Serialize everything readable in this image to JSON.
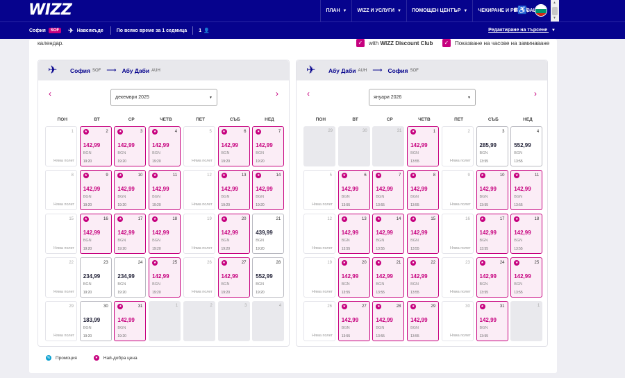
{
  "logo": "WIZZ",
  "nav": [
    {
      "label": "ПЛАН",
      "caret": true
    },
    {
      "label": "WIZZ И УСЛУГИ",
      "caret": true
    },
    {
      "label": "ПОМОЩЕН ЦЕНТЪР",
      "caret": true
    },
    {
      "label": "ЧЕКИРАНЕ И РЕЗЕРВАЦИИ",
      "caret": false
    }
  ],
  "login": "ВХОД",
  "subbar": {
    "origin": "София",
    "origin_code": "SOF",
    "destination": "Навсякъде",
    "when": "По всяко време за 1 седмица",
    "pax": "1",
    "edit": "Редактиране на търсене"
  },
  "intro": "календар.",
  "options": {
    "discount_prefix": "with ",
    "discount_bold": "WIZZ Discount Club",
    "show_times": "Показване на часове на заминаване"
  },
  "no_flight": "Няма полет",
  "weekdays": [
    "ПОН",
    "ВТ",
    "СР",
    "ЧЕТВ",
    "ПЕТ",
    "СЪБ",
    "НЕД"
  ],
  "legend": {
    "promo": "Промоция",
    "best": "Най-добра цена"
  },
  "colors": {
    "brand_blue": "#06038d",
    "brand_pink": "#c6007e"
  },
  "panels": [
    {
      "from": "София",
      "from_code": "SOF",
      "to": "Абу Даби",
      "to_code": "AUH",
      "month": "декември 2025",
      "cells": [
        [
          {
            "d": "1",
            "k": "empty"
          },
          {
            "d": "2",
            "k": "best",
            "p": "142,99",
            "c": "BGN",
            "t": "19:20"
          },
          {
            "d": "3",
            "k": "best",
            "p": "142,99",
            "c": "BGN",
            "t": "19:20"
          },
          {
            "d": "4",
            "k": "best",
            "p": "142,99",
            "c": "BGN",
            "t": "19:20"
          },
          {
            "d": "5",
            "k": "empty"
          },
          {
            "d": "6",
            "k": "best",
            "p": "142,99",
            "c": "BGN",
            "t": "19:20"
          },
          {
            "d": "7",
            "k": "best",
            "p": "142,99",
            "c": "BGN",
            "t": "19:20"
          }
        ],
        [
          {
            "d": "8",
            "k": "empty"
          },
          {
            "d": "9",
            "k": "best",
            "p": "142,99",
            "c": "BGN",
            "t": "19:20"
          },
          {
            "d": "10",
            "k": "best",
            "p": "142,99",
            "c": "BGN",
            "t": "19:20"
          },
          {
            "d": "11",
            "k": "best",
            "p": "142,99",
            "c": "BGN",
            "t": "19:20"
          },
          {
            "d": "12",
            "k": "empty"
          },
          {
            "d": "13",
            "k": "best",
            "p": "142,99",
            "c": "BGN",
            "t": "19:20"
          },
          {
            "d": "14",
            "k": "best",
            "p": "142,99",
            "c": "BGN",
            "t": "19:20"
          }
        ],
        [
          {
            "d": "15",
            "k": "empty"
          },
          {
            "d": "16",
            "k": "best",
            "p": "142,99",
            "c": "BGN",
            "t": "19:20"
          },
          {
            "d": "17",
            "k": "best",
            "p": "142,99",
            "c": "BGN",
            "t": "19:20"
          },
          {
            "d": "18",
            "k": "best",
            "p": "142,99",
            "c": "BGN",
            "t": "19:20"
          },
          {
            "d": "19",
            "k": "empty"
          },
          {
            "d": "20",
            "k": "best",
            "p": "142,99",
            "c": "BGN",
            "t": "19:20"
          },
          {
            "d": "21",
            "k": "price",
            "p": "439,99",
            "c": "BGN",
            "t": "19:20"
          }
        ],
        [
          {
            "d": "22",
            "k": "empty"
          },
          {
            "d": "23",
            "k": "price",
            "p": "234,99",
            "c": "BGN",
            "t": "19:20"
          },
          {
            "d": "24",
            "k": "price",
            "p": "234,99",
            "c": "BGN",
            "t": "19:20"
          },
          {
            "d": "25",
            "k": "best",
            "p": "142,99",
            "c": "BGN",
            "t": "19:20"
          },
          {
            "d": "26",
            "k": "empty"
          },
          {
            "d": "27",
            "k": "best",
            "p": "142,99",
            "c": "BGN",
            "t": "19:20"
          },
          {
            "d": "28",
            "k": "price",
            "p": "552,99",
            "c": "BGN",
            "t": "19:20"
          }
        ],
        [
          {
            "d": "29",
            "k": "empty"
          },
          {
            "d": "30",
            "k": "price",
            "p": "183,99",
            "c": "BGN",
            "t": "19:20"
          },
          {
            "d": "31",
            "k": "best",
            "p": "142,99",
            "c": "BGN",
            "t": "19:20"
          },
          {
            "d": "1",
            "k": "out"
          },
          {
            "d": "2",
            "k": "out"
          },
          {
            "d": "3",
            "k": "out"
          },
          {
            "d": "4",
            "k": "out"
          }
        ]
      ]
    },
    {
      "from": "Абу Даби",
      "from_code": "AUH",
      "to": "София",
      "to_code": "SOF",
      "month": "януари 2026",
      "cells": [
        [
          {
            "d": "29",
            "k": "out"
          },
          {
            "d": "30",
            "k": "out"
          },
          {
            "d": "31",
            "k": "out"
          },
          {
            "d": "1",
            "k": "best",
            "p": "142,99",
            "c": "BGN",
            "t": "13:55"
          },
          {
            "d": "2",
            "k": "empty"
          },
          {
            "d": "3",
            "k": "price",
            "p": "285,99",
            "c": "BGN",
            "t": "13:55"
          },
          {
            "d": "4",
            "k": "price",
            "p": "552,99",
            "c": "BGN",
            "t": "13:55"
          }
        ],
        [
          {
            "d": "5",
            "k": "empty"
          },
          {
            "d": "6",
            "k": "best",
            "p": "142,99",
            "c": "BGN",
            "t": "13:55"
          },
          {
            "d": "7",
            "k": "best",
            "p": "142,99",
            "c": "BGN",
            "t": "13:55"
          },
          {
            "d": "8",
            "k": "best",
            "p": "142,99",
            "c": "BGN",
            "t": "13:55"
          },
          {
            "d": "9",
            "k": "empty"
          },
          {
            "d": "10",
            "k": "best",
            "p": "142,99",
            "c": "BGN",
            "t": "13:55"
          },
          {
            "d": "11",
            "k": "best",
            "p": "142,99",
            "c": "BGN",
            "t": "13:55"
          }
        ],
        [
          {
            "d": "12",
            "k": "empty"
          },
          {
            "d": "13",
            "k": "best",
            "p": "142,99",
            "c": "BGN",
            "t": "13:55"
          },
          {
            "d": "14",
            "k": "best",
            "p": "142,99",
            "c": "BGN",
            "t": "13:55"
          },
          {
            "d": "15",
            "k": "best",
            "p": "142,99",
            "c": "BGN",
            "t": "13:55"
          },
          {
            "d": "16",
            "k": "empty"
          },
          {
            "d": "17",
            "k": "best",
            "p": "142,99",
            "c": "BGN",
            "t": "13:55"
          },
          {
            "d": "18",
            "k": "best",
            "p": "142,99",
            "c": "BGN",
            "t": "13:55"
          }
        ],
        [
          {
            "d": "19",
            "k": "empty"
          },
          {
            "d": "20",
            "k": "best",
            "p": "142,99",
            "c": "BGN",
            "t": "13:55"
          },
          {
            "d": "21",
            "k": "best",
            "p": "142,99",
            "c": "BGN",
            "t": "13:55"
          },
          {
            "d": "22",
            "k": "best",
            "p": "142,99",
            "c": "BGN",
            "t": "13:55"
          },
          {
            "d": "23",
            "k": "empty"
          },
          {
            "d": "24",
            "k": "best",
            "p": "142,99",
            "c": "BGN",
            "t": "13:55"
          },
          {
            "d": "25",
            "k": "best",
            "p": "142,99",
            "c": "BGN",
            "t": "13:55"
          }
        ],
        [
          {
            "d": "26",
            "k": "empty"
          },
          {
            "d": "27",
            "k": "best",
            "p": "142,99",
            "c": "BGN",
            "t": "13:55"
          },
          {
            "d": "28",
            "k": "best",
            "p": "142,99",
            "c": "BGN",
            "t": "13:55"
          },
          {
            "d": "29",
            "k": "best",
            "p": "142,99",
            "c": "BGN",
            "t": "13:55"
          },
          {
            "d": "30",
            "k": "empty"
          },
          {
            "d": "31",
            "k": "best",
            "p": "142,99",
            "c": "BGN",
            "t": "13:55"
          },
          {
            "d": "1",
            "k": "out"
          }
        ]
      ]
    }
  ]
}
